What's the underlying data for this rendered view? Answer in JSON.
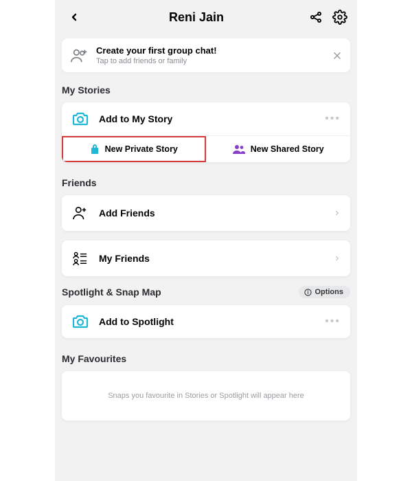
{
  "header": {
    "title": "Reni Jain"
  },
  "banner": {
    "title": "Create your first group chat!",
    "subtitle": "Tap to add friends or family"
  },
  "sections": {
    "stories": {
      "title": "My Stories",
      "add": "Add to My Story",
      "new_private": "New Private Story",
      "new_shared": "New Shared Story"
    },
    "friends": {
      "title": "Friends",
      "add": "Add Friends",
      "my": "My Friends"
    },
    "spotlight": {
      "title": "Spotlight & Snap Map",
      "options": "Options",
      "add": "Add to Spotlight"
    },
    "favourites": {
      "title": "My Favourites",
      "empty": "Snaps you favourite in Stories or Spotlight will appear here"
    }
  },
  "colors": {
    "accent_blue": "#1fb7d6",
    "accent_purple": "#8a3fc9",
    "accent_lock": "#1fb7d6"
  }
}
